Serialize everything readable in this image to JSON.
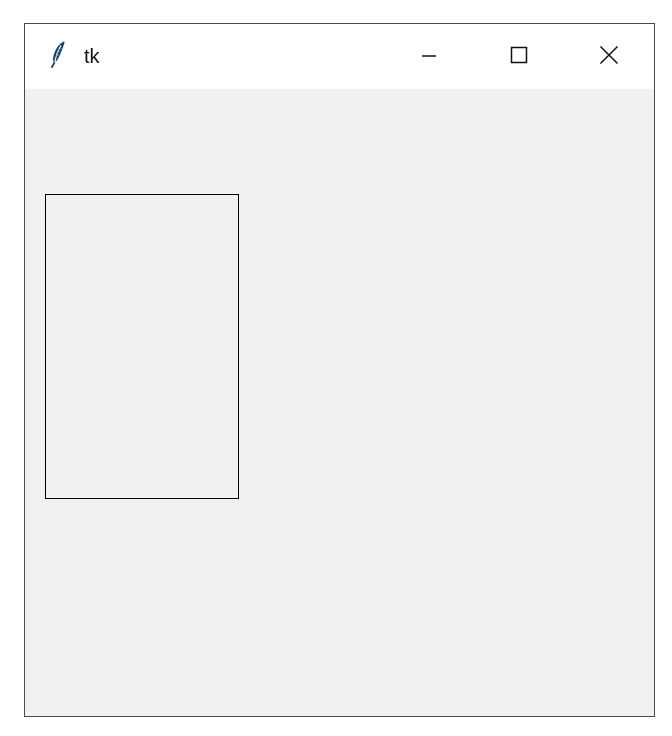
{
  "window": {
    "title": "tk",
    "app_icon": "tk-feather-icon",
    "controls": {
      "minimize_icon": "minimize-icon",
      "maximize_icon": "maximize-icon",
      "close_icon": "close-icon"
    }
  },
  "canvas": {
    "shapes": [
      {
        "type": "rectangle",
        "stroke": "#000000",
        "fill": "none"
      }
    ]
  },
  "colors": {
    "titlebar_background": "#ffffff",
    "window_background": "#f0f0f0",
    "border": "#4a4a4a",
    "text": "#111111"
  }
}
